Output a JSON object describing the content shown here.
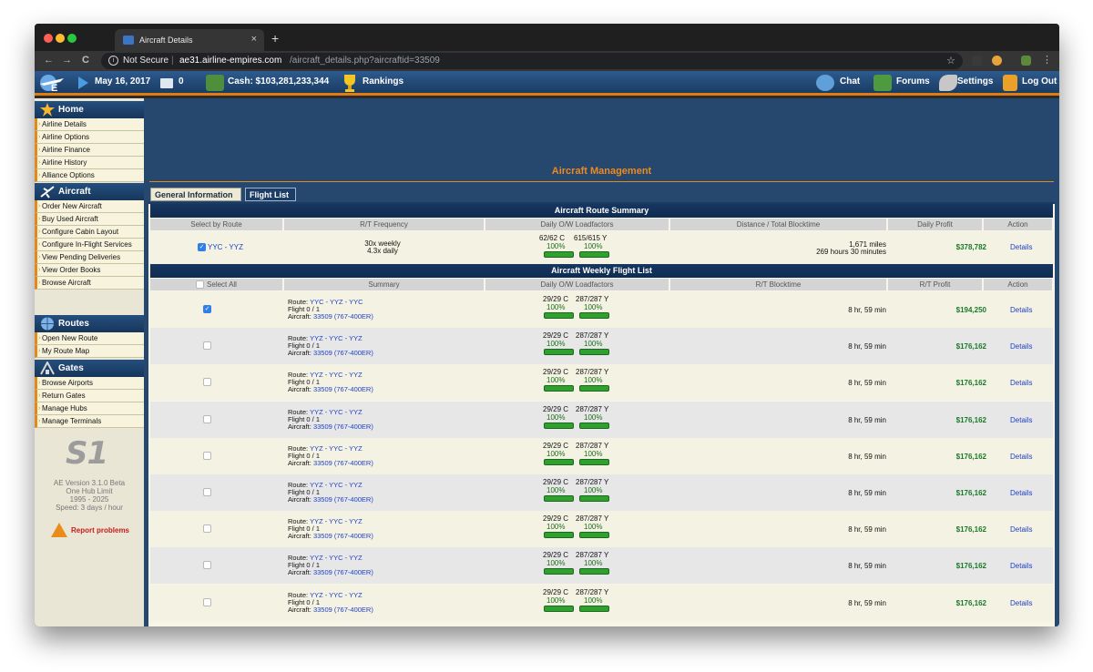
{
  "browser": {
    "tab_title": "Aircraft Details",
    "tab_close": "×",
    "new_tab": "+",
    "security_label": "Not Secure",
    "url_host": "ae31.airline-empires.com",
    "url_path": "/aircraft_details.php?aircraftid=33509",
    "back": "←",
    "forward": "→",
    "reload": "C",
    "star": "☆"
  },
  "header": {
    "date": "May 16, 2017",
    "mail_count": "0",
    "cash": "Cash: $103,281,233,344",
    "rankings": "Rankings",
    "chat": "Chat",
    "forums": "Forums",
    "settings": "Settings",
    "logout": "Log Out",
    "bar_color": "#e07d12"
  },
  "sidebar": {
    "home_title": "Home",
    "home_items": [
      "Airline Details",
      "Airline Options",
      "Airline Finance",
      "Airline History",
      "Alliance Options"
    ],
    "aircraft_title": "Aircraft",
    "aircraft_items": [
      "Order New Aircraft",
      "Buy Used Aircraft",
      "Configure Cabin Layout",
      "Configure In-Flight Services",
      "View Pending Deliveries",
      "View Order Books",
      "Browse Aircraft"
    ],
    "routes_title": "Routes",
    "routes_items": [
      "Open New Route",
      "My Route Map"
    ],
    "gates_title": "Gates",
    "gates_items": [
      "Browse Airports",
      "Return Gates",
      "Manage Hubs",
      "Manage Terminals"
    ],
    "server_logo": "S1",
    "version": "AE Version 3.1.0 Beta",
    "hub_limit": "One Hub Limit",
    "years": "1995 - 2025",
    "speed": "Speed: 3 days / hour",
    "report": "Report problems"
  },
  "main": {
    "title": "Aircraft Management",
    "tab_general": "General Information",
    "tab_flight": "Flight List",
    "route_summary_title": "Aircraft Route Summary",
    "route_summary_headers": [
      "Select by Route",
      "R/T Frequency",
      "Daily O/W Loadfactors",
      "Distance / Total Blocktime",
      "Daily Profit",
      "Action"
    ],
    "route_summary": {
      "route": "YYC - YYZ",
      "freq_weekly": "30x weekly",
      "freq_daily": "4.3x daily",
      "lf_c": "62/62 C",
      "lf_y": "615/615 Y",
      "pct_c": "100%",
      "pct_y": "100%",
      "lf_c_fill": 1.0,
      "lf_y_fill": 1.0,
      "distance": "1,671 miles",
      "blocktime": "269 hours 30 minutes",
      "profit": "$378,782",
      "action": "Details"
    },
    "weekly_title": "Aircraft Weekly Flight List",
    "weekly_headers": [
      "Select All",
      "Summary",
      "Daily O/W Loadfactors",
      "R/T Blocktime",
      "R/T Profit",
      "Action"
    ],
    "flights": [
      {
        "route": "YYC - YYZ - YYC",
        "flight": "Flight 0 / 1",
        "aircraft_id": "33509",
        "aircraft_type": "(767-400ER)",
        "lf_c": "29/29 C",
        "lf_y": "287/287 Y",
        "pct_c": "100%",
        "pct_y": "100%",
        "blocktime": "8 hr, 59 min",
        "profit": "$194,250",
        "action": "Details",
        "checked": true
      },
      {
        "route": "YYZ - YYC - YYZ",
        "flight": "Flight 0 / 1",
        "aircraft_id": "33509",
        "aircraft_type": "(767-400ER)",
        "lf_c": "29/29 C",
        "lf_y": "287/287 Y",
        "pct_c": "100%",
        "pct_y": "100%",
        "blocktime": "8 hr, 59 min",
        "profit": "$176,162",
        "action": "Details",
        "checked": false
      },
      {
        "route": "YYZ - YYC - YYZ",
        "flight": "Flight 0 / 1",
        "aircraft_id": "33509",
        "aircraft_type": "(767-400ER)",
        "lf_c": "29/29 C",
        "lf_y": "287/287 Y",
        "pct_c": "100%",
        "pct_y": "100%",
        "blocktime": "8 hr, 59 min",
        "profit": "$176,162",
        "action": "Details",
        "checked": false
      },
      {
        "route": "YYZ - YYC - YYZ",
        "flight": "Flight 0 / 1",
        "aircraft_id": "33509",
        "aircraft_type": "(767-400ER)",
        "lf_c": "29/29 C",
        "lf_y": "287/287 Y",
        "pct_c": "100%",
        "pct_y": "100%",
        "blocktime": "8 hr, 59 min",
        "profit": "$176,162",
        "action": "Details",
        "checked": false
      },
      {
        "route": "YYZ - YYC - YYZ",
        "flight": "Flight 0 / 1",
        "aircraft_id": "33509",
        "aircraft_type": "(767-400ER)",
        "lf_c": "29/29 C",
        "lf_y": "287/287 Y",
        "pct_c": "100%",
        "pct_y": "100%",
        "blocktime": "8 hr, 59 min",
        "profit": "$176,162",
        "action": "Details",
        "checked": false
      },
      {
        "route": "YYZ - YYC - YYZ",
        "flight": "Flight 0 / 1",
        "aircraft_id": "33509",
        "aircraft_type": "(767-400ER)",
        "lf_c": "29/29 C",
        "lf_y": "287/287 Y",
        "pct_c": "100%",
        "pct_y": "100%",
        "blocktime": "8 hr, 59 min",
        "profit": "$176,162",
        "action": "Details",
        "checked": false
      },
      {
        "route": "YYZ - YYC - YYZ",
        "flight": "Flight 0 / 1",
        "aircraft_id": "33509",
        "aircraft_type": "(767-400ER)",
        "lf_c": "29/29 C",
        "lf_y": "287/287 Y",
        "pct_c": "100%",
        "pct_y": "100%",
        "blocktime": "8 hr, 59 min",
        "profit": "$176,162",
        "action": "Details",
        "checked": false
      },
      {
        "route": "YYZ - YYC - YYZ",
        "flight": "Flight 0 / 1",
        "aircraft_id": "33509",
        "aircraft_type": "(767-400ER)",
        "lf_c": "29/29 C",
        "lf_y": "287/287 Y",
        "pct_c": "100%",
        "pct_y": "100%",
        "blocktime": "8 hr, 59 min",
        "profit": "$176,162",
        "action": "Details",
        "checked": false
      },
      {
        "route": "YYZ - YYC - YYZ",
        "flight": "Flight 0 / 1",
        "aircraft_id": "33509",
        "aircraft_type": "(767-400ER)",
        "lf_c": "29/29 C",
        "lf_y": "287/287 Y",
        "pct_c": "100%",
        "pct_y": "100%",
        "blocktime": "8 hr, 59 min",
        "profit": "$176,162",
        "action": "Details",
        "checked": false
      }
    ],
    "labels": {
      "route": "Route:",
      "aircraft": "Aircraft:"
    },
    "colors": {
      "profit": "#1a7a2a",
      "link": "#1d3fc6",
      "loadbar": "#2fa12f",
      "title": "#f08a1d"
    }
  }
}
